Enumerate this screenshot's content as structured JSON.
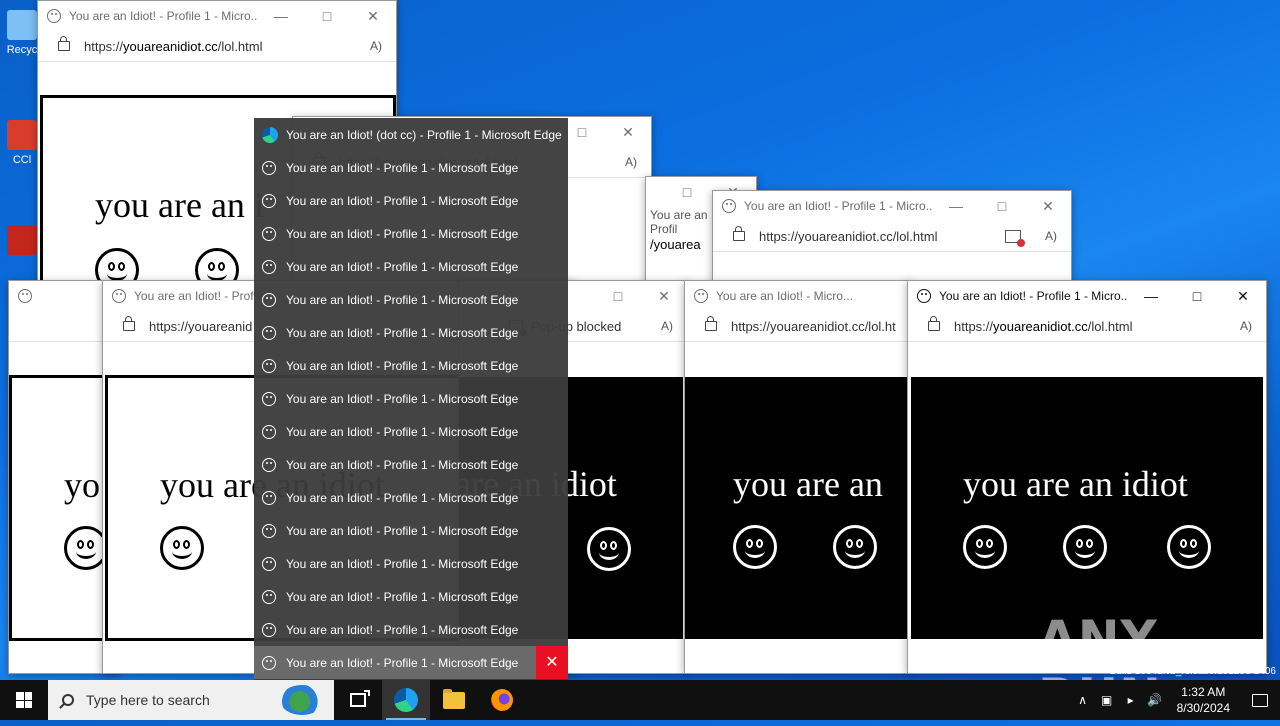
{
  "desktop": {
    "icons": [
      {
        "label": "Recyc",
        "color": "#6cb6ff"
      },
      {
        "label": "CCl",
        "color": "#d93c2b"
      },
      {
        "label": "",
        "color": "#c4261d"
      }
    ]
  },
  "windows": {
    "title_inactive": "You are an Idiot! - Profile 1 - Micro...",
    "title_active": "You are an Idiot! - Profile 1 - Micro...",
    "url_prefix": "https://",
    "url_host": "youareanidiot.cc",
    "url_path": "/lol.html",
    "url_truncated": "https://youareanidiot.cc/lol.ht",
    "url_partial": "https://youareanid",
    "url_partial2": "/youarea",
    "url_mid": "https://youareanidiot.cc/lol.html",
    "popup_blocked": "Pop-up blocked",
    "read_aloud": "A)",
    "minimize": "—",
    "maximize": "□",
    "close": "✕",
    "partial_title": "You are an Idiot! - Profile",
    "partial_title2": "You are an Idiot! - Profil",
    "partial_title3": "You are an Idiot! - Micro..."
  },
  "content": {
    "text_full": "you are an idiot",
    "text_an": "you are an",
    "text_ani": "you are an i",
    "text_yo": "yo",
    "text_are": "are an idiot"
  },
  "preview_menu": {
    "first_title": "You are an Idiot! (dot cc) - Profile 1 - Microsoft Edge",
    "items": [
      "You are an Idiot! - Profile 1 - Microsoft Edge",
      "You are an Idiot! - Profile 1 - Microsoft Edge",
      "You are an Idiot! - Profile 1 - Microsoft Edge",
      "You are an Idiot! - Profile 1 - Microsoft Edge",
      "You are an Idiot! - Profile 1 - Microsoft Edge",
      "You are an Idiot! - Profile 1 - Microsoft Edge",
      "You are an Idiot! - Profile 1 - Microsoft Edge",
      "You are an Idiot! - Profile 1 - Microsoft Edge",
      "You are an Idiot! - Profile 1 - Microsoft Edge",
      "You are an Idiot! - Profile 1 - Microsoft Edge",
      "You are an Idiot! - Profile 1 - Microsoft Edge",
      "You are an Idiot! - Profile 1 - Microsoft Edge",
      "You are an Idiot! - Profile 1 - Microsoft Edge",
      "You are an Idiot! - Profile 1 - Microsoft Edge",
      "You are an Idiot! - Profile 1 - Microsoft Edge"
    ],
    "last_item": "You are an Idiot! - Profile 1 - Microsoft Edge",
    "close": "✕"
  },
  "taskbar": {
    "search_placeholder": "Type here to search",
    "time": "1:32 AM",
    "date": "8/30/2024",
    "tray_up": "∧",
    "accent": "#76b9ed"
  },
  "watermark": "ANY RUN",
  "build_text": "Build 19041.vb_release.191206-1406"
}
